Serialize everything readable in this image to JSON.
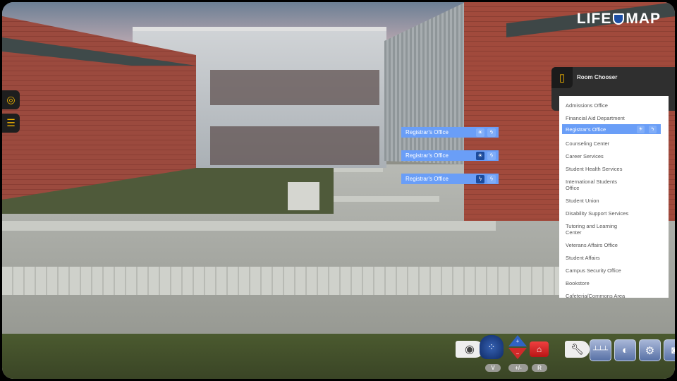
{
  "brand": {
    "logo": "LIFE MAP"
  },
  "sidebar": {
    "items": [
      {
        "icon": "locate-icon",
        "glyph": "◎"
      },
      {
        "icon": "list-icon",
        "glyph": "☰"
      }
    ]
  },
  "scene_tags": [
    {
      "label": "Registrar's Office",
      "active": "none"
    },
    {
      "label": "Registrar's Office",
      "active": "sun"
    },
    {
      "label": "Registrar's Office",
      "active": "bolt"
    }
  ],
  "room_chooser": {
    "title": "Room Chooser",
    "items": [
      "Admissions Office",
      "Financial Aid Department",
      "Registrar's Office",
      "Counseling Center",
      "Career Services",
      "Student Health Services",
      "International Students Office",
      "Student Union",
      "Disability Support Services",
      "Tutoring and Learning Center",
      "Veterans Affairs Office",
      "Student Affairs",
      "Campus Security Office",
      "Bookstore",
      "Cafeteria/Commons Area"
    ],
    "selected": "Registrar's Office"
  },
  "toolbar": {
    "view_key": "V",
    "zoom_key": "+/-",
    "reset_key": "R",
    "tools": [
      "eye-icon",
      "view-mode-icon",
      "zoom-icon",
      "home-icon",
      "wrench-icon",
      "ruler-icon",
      "contrast-icon",
      "settings-icon",
      "camera-icon"
    ]
  },
  "colors": {
    "accent": "#6a9ef7",
    "highlight": "#f0b400"
  }
}
